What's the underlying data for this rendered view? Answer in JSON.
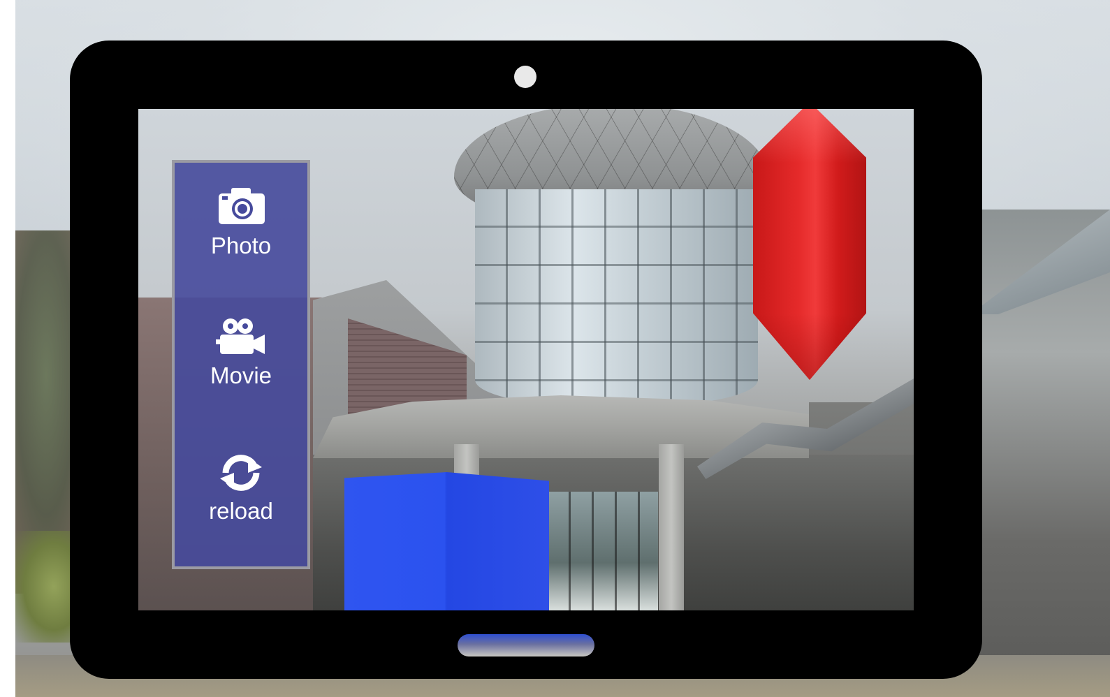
{
  "controls": {
    "photo": {
      "label": "Photo",
      "icon": "camera-icon"
    },
    "movie": {
      "label": "Movie",
      "icon": "movie-camera-icon"
    },
    "reload": {
      "label": "reload",
      "icon": "reload-icon"
    }
  },
  "colors": {
    "panel": "#464a9c",
    "panel_border": "#9b9ba3",
    "ar_red": "#e52a2a",
    "ar_blue": "#2f55f0",
    "frame": "#000000"
  }
}
